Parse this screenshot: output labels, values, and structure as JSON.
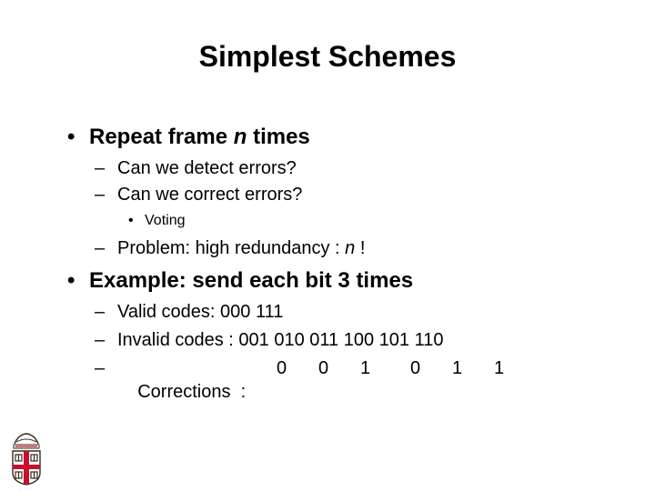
{
  "slide": {
    "title": "Simplest Schemes",
    "bullets": [
      {
        "marker": "•",
        "text_before": "Repeat frame ",
        "italic": "n",
        "text_after": " times",
        "sub": [
          {
            "marker": "–",
            "text": "Can we detect errors?"
          },
          {
            "marker": "–",
            "text": "Can we correct errors?",
            "sub": [
              {
                "marker": "•",
                "text": "Voting"
              }
            ]
          },
          {
            "marker": "–",
            "text_before": "Problem: high redundancy : ",
            "italic": "n",
            "text_after": " !"
          }
        ]
      },
      {
        "marker": "•",
        "text": "Example: send each bit 3 times",
        "sub": [
          {
            "marker": "–",
            "label": "Valid codes: ",
            "codes": [
              "000",
              "111"
            ]
          },
          {
            "marker": "–",
            "label": "Invalid codes : ",
            "codes": [
              "001",
              "010",
              "011",
              "100",
              "101",
              "110"
            ]
          },
          {
            "marker": "–",
            "label": "Corrections  : ",
            "values": [
              "0",
              "0",
              "1",
              "0",
              "1",
              "1"
            ]
          }
        ]
      }
    ]
  },
  "logo": {
    "icon": "university-shield-logo",
    "colors": {
      "cross": "#c8102e",
      "outline": "#3a2a1a"
    }
  }
}
